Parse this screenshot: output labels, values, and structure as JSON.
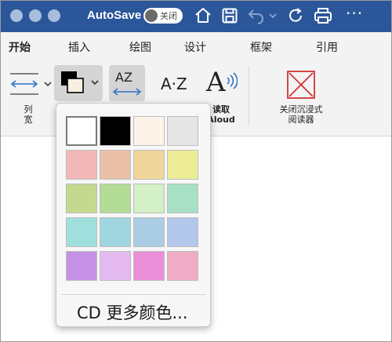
{
  "titlebar": {
    "autosave_label": "AutoSave",
    "toggle_label": "关闭",
    "bg_color": "#2b579a",
    "icons": [
      "home-icon",
      "save-icon",
      "undo-icon",
      "chevron-down-icon",
      "refresh-icon",
      "print-icon"
    ]
  },
  "tabs": [
    {
      "label": "开始"
    },
    {
      "label": "插入"
    },
    {
      "label": "绘图"
    },
    {
      "label": "设计"
    },
    {
      "label": "框架"
    },
    {
      "label": "引用"
    }
  ],
  "ribbon": {
    "column_width_label": "列\n宽",
    "read_aloud_label": "读取\nAloud",
    "close_reader_label": "关闭沉浸式\n阅读器",
    "text_spacing_icon_text": "AZ",
    "syllables_icon_text": "A·Z",
    "read_aloud_icon_text": "A"
  },
  "color_menu": {
    "swatches": [
      [
        "#ffffff",
        "#000000",
        "#fcf4e8",
        "#e6e6e6"
      ],
      [
        "#f2b8b8",
        "#ebc0a8",
        "#efd59a",
        "#eded98"
      ],
      [
        "#c4d98e",
        "#b2dc96",
        "#d3f0c6",
        "#a8e0c6"
      ],
      [
        "#a0e0dc",
        "#a0d6e0",
        "#abcde4",
        "#b4c8ec"
      ],
      [
        "#c692e8",
        "#e4baf0",
        "#ea8ed8",
        "#f0acc4"
      ]
    ],
    "selected": "#ffffff",
    "more_colors_label": "CD 更多颜色..."
  }
}
